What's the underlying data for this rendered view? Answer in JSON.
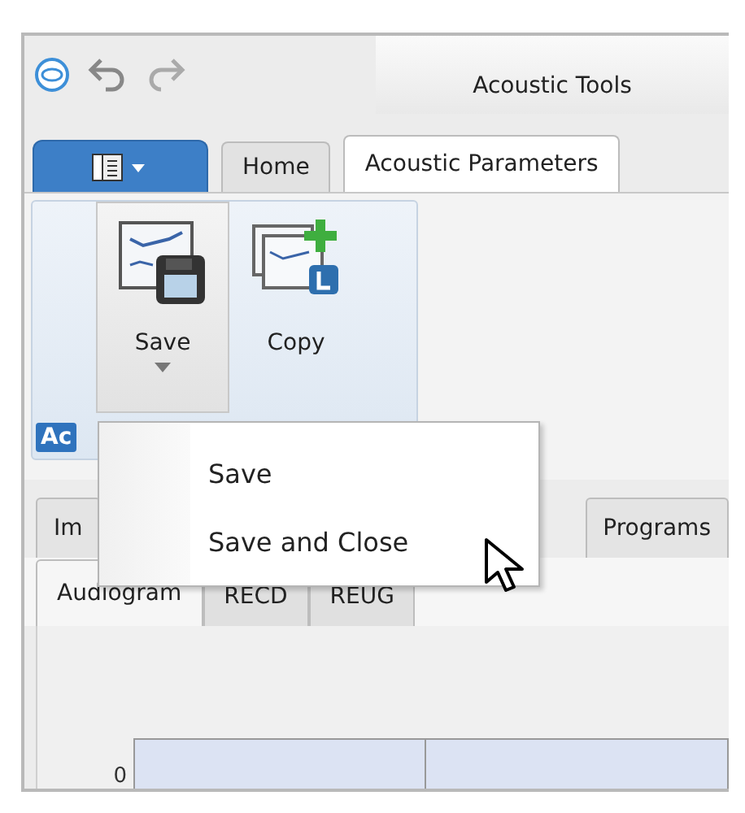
{
  "app": {
    "title": "Acoustic Tools"
  },
  "ribbon_tabs": [
    {
      "label": "Home",
      "selected": false
    },
    {
      "label": "Acoustic Parameters",
      "selected": true
    }
  ],
  "ribbon_buttons": [
    {
      "label": "Save",
      "kind": "split",
      "pressed": true
    },
    {
      "label": "Copy",
      "kind": "plain",
      "pressed": false
    }
  ],
  "group_label": "Ac",
  "dropdown_menu": [
    {
      "label": "Save"
    },
    {
      "label": "Save and Close"
    }
  ],
  "document_tabs": [
    {
      "label": "Im",
      "selected": false
    },
    {
      "label": "Programs",
      "selected": false
    }
  ],
  "view_tabs": [
    {
      "label": "Audiogram",
      "selected": true
    },
    {
      "label": "RECD",
      "selected": false
    },
    {
      "label": "REUG",
      "selected": false
    }
  ],
  "chart": {
    "tick_label": "0"
  }
}
